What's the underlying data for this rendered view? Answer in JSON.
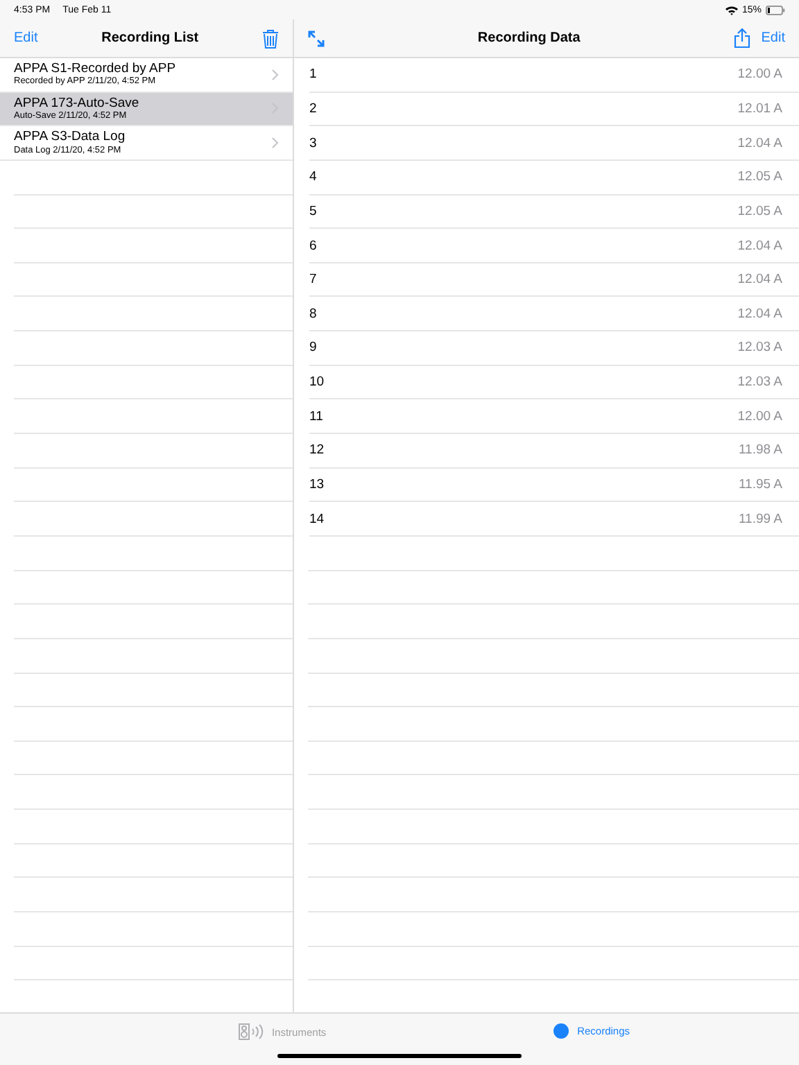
{
  "status_bar": {
    "time": "4:53 PM",
    "date": "Tue Feb 11",
    "battery_text": "15%"
  },
  "list_pane": {
    "edit": "Edit",
    "title": "Recording List",
    "items": [
      {
        "title": "APPA S1-Recorded by APP",
        "subtitle": "Recorded by APP  2/11/20, 4:52 PM",
        "selected": false
      },
      {
        "title": "APPA 173-Auto-Save",
        "subtitle": "Auto-Save  2/11/20, 4:52 PM",
        "selected": true
      },
      {
        "title": "APPA S3-Data Log",
        "subtitle": "Data Log  2/11/20, 4:52 PM",
        "selected": false
      }
    ]
  },
  "data_pane": {
    "title": "Recording Data",
    "edit": "Edit",
    "rows": [
      {
        "index": "1",
        "value": "12.00 A"
      },
      {
        "index": "2",
        "value": "12.01 A"
      },
      {
        "index": "3",
        "value": "12.04 A"
      },
      {
        "index": "4",
        "value": "12.05 A"
      },
      {
        "index": "5",
        "value": "12.05 A"
      },
      {
        "index": "6",
        "value": "12.04 A"
      },
      {
        "index": "7",
        "value": "12.04 A"
      },
      {
        "index": "8",
        "value": "12.04 A"
      },
      {
        "index": "9",
        "value": "12.03 A"
      },
      {
        "index": "10",
        "value": "12.03 A"
      },
      {
        "index": "11",
        "value": "12.00 A"
      },
      {
        "index": "12",
        "value": "11.98 A"
      },
      {
        "index": "13",
        "value": "11.95 A"
      },
      {
        "index": "14",
        "value": "11.99 A"
      }
    ]
  },
  "tab_bar": [
    {
      "kind": "instruments",
      "label": "Instruments",
      "selected": false
    },
    {
      "kind": "recordings",
      "label": "Recordings",
      "selected": true
    }
  ]
}
